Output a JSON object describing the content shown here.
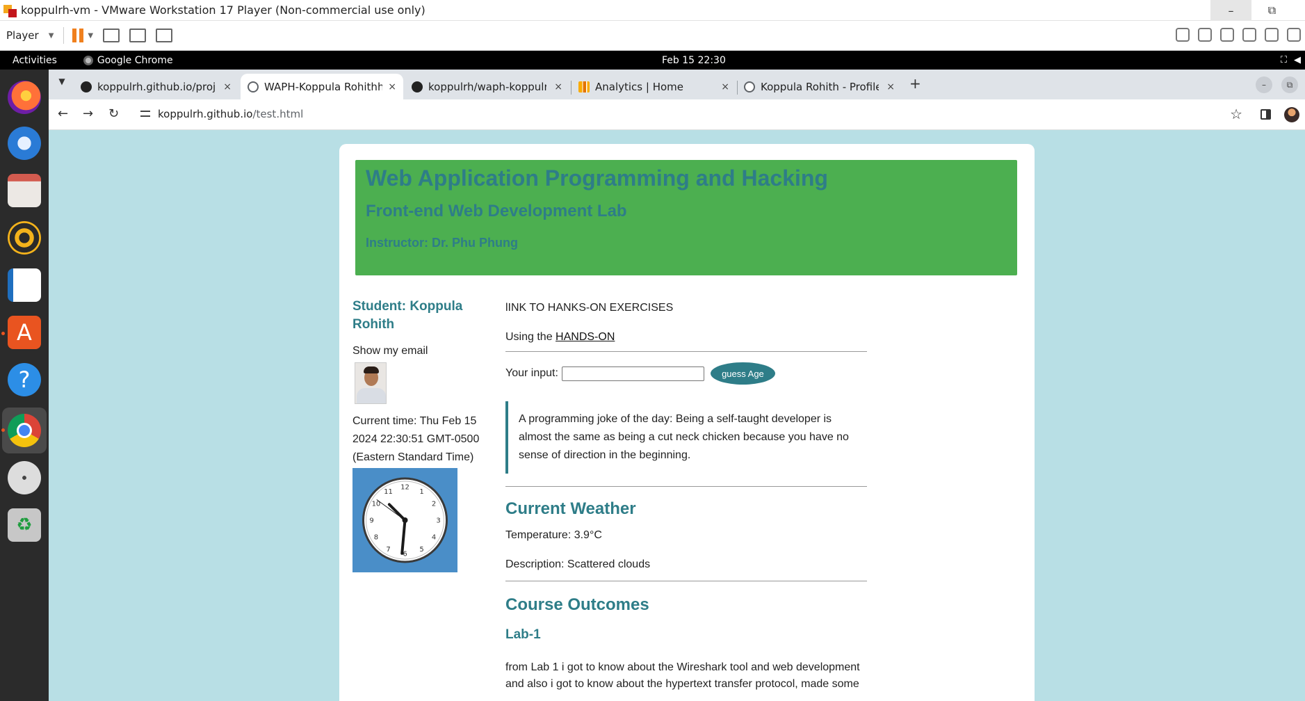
{
  "vm": {
    "title": "koppulrh-vm - VMware Workstation 17 Player (Non-commercial use only)",
    "player_menu": "Player",
    "minimize": "–",
    "restore": "⧉"
  },
  "gnome": {
    "activities": "Activities",
    "app_name": "Google Chrome",
    "clock": "Feb 15  22:30"
  },
  "chrome": {
    "tabs": [
      {
        "label": "koppulrh.github.io/proje",
        "icon": "github-icon"
      },
      {
        "label": "WAPH-Koppula Rohithh",
        "icon": "globe-icon"
      },
      {
        "label": "koppulrh/waph-koppulrh",
        "icon": "github-icon"
      },
      {
        "label": "Analytics | Home",
        "icon": "analytics-icon"
      },
      {
        "label": "Koppula Rohith - Profile",
        "icon": "globe-icon"
      }
    ],
    "close_glyph": "×",
    "new_tab": "+",
    "url_host": "koppulrh.github.io",
    "url_path": "/test.html"
  },
  "page": {
    "title": "Web Application Programming and Hacking",
    "subtitle": "Front-end Web Development Lab",
    "instructor": "Instructor: Dr. Phu Phung",
    "student": "Student: Koppula Rohith",
    "show_email": "Show my email",
    "current_time": "Current time: Thu Feb 15 2024 22:30:51 GMT-0500 (Eastern Standard Time)",
    "link_heading": "lINK TO HANKS-ON EXERCISES",
    "using_prefix": "Using the ",
    "hands_on_link": "HANDS-ON",
    "input_label": "Your input:",
    "input_value": "",
    "guess_button": "guess Age",
    "joke": "A programming joke of the day: Being a self-taught developer is almost the same as being a cut neck chicken because you have no sense of direction in the beginning.",
    "weather_heading": "Current Weather",
    "temperature": "Temperature: 3.9°C",
    "description": "Description: Scattered clouds",
    "outcomes_heading": "Course Outcomes",
    "lab1_heading": "Lab-1",
    "lab1_text": "from Lab 1 i got to know about the Wireshark tool and web development and also i got to know about the hypertext transfer protocol, made some"
  },
  "clock": {
    "numbers": [
      "12",
      "1",
      "2",
      "3",
      "4",
      "5",
      "6",
      "7",
      "8",
      "9",
      "10",
      "11"
    ],
    "time_shown": "22:30:51"
  },
  "colors": {
    "accent_teal": "#2e7d88",
    "header_green": "#4caf50",
    "page_bg": "#b8dfe5"
  }
}
